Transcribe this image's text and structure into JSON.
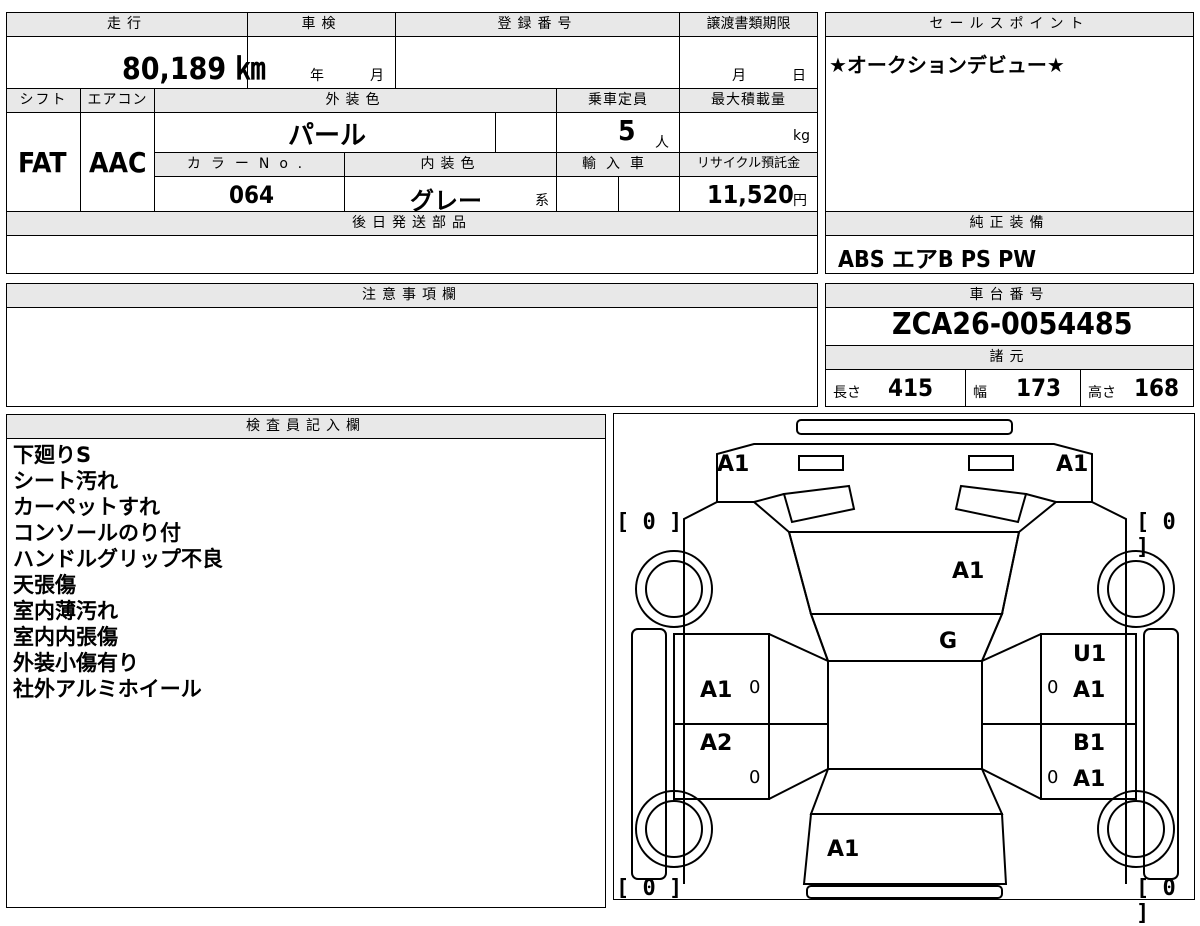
{
  "spec": {
    "mileage_label": "走行",
    "mileage": "80,189 ㎞",
    "shaken_label": "車検",
    "shaken_year_unit": "年",
    "shaken_month_unit": "月",
    "reg_no_label": "登録番号",
    "transfer_label": "譲渡書類期限",
    "transfer_month_unit": "月",
    "transfer_day_unit": "日",
    "shift_label": "シフト",
    "aircon_label": "エアコン",
    "ext_color_label": "外装色",
    "capacity_label": "乗車定員",
    "max_load_label": "最大積載量",
    "shift": "FAT",
    "aircon": "AAC",
    "ext_color": "パール",
    "capacity": "5",
    "capacity_unit": "人",
    "max_load_unit": "kg",
    "color_no_label": "カラーNo.",
    "int_color_label": "内装色",
    "import_label": "輸入車",
    "recycle_label": "リサイクル預託金",
    "color_no": "064",
    "int_color": "グレー",
    "int_color_suffix": "系",
    "recycle_fee": "11,520",
    "recycle_unit": "円",
    "later_parts_label": "後日発送部品"
  },
  "sales_point": {
    "label": "セールスポイント",
    "text": "★オークションデビュー★"
  },
  "genuine_equipment": {
    "label": "純正装備",
    "text": "ABS エアB PS PW"
  },
  "notes_label": "注意事項欄",
  "chassis": {
    "label": "車台番号",
    "number": "ZCA26-0054485"
  },
  "dimensions": {
    "label": "諸元",
    "length_label": "長さ",
    "length": "415",
    "width_label": "幅",
    "width": "173",
    "height_label": "高さ",
    "height": "168"
  },
  "inspector": {
    "label": "検査員記入欄",
    "notes": [
      "下廻りS",
      "シート汚れ",
      "カーペットすれ",
      "コンソールのり付",
      "ハンドルグリップ不良",
      "天張傷",
      "室内薄汚れ",
      "室内内張傷",
      "外装小傷有り",
      "社外アルミホイール"
    ]
  },
  "diagram": {
    "front_left": "A1",
    "front_right": "A1",
    "hood": "A1",
    "windshield": "G",
    "right_front_door_top": "U1",
    "right_front_door": "A1",
    "left_front_door": "A1",
    "left_rear_door": "A2",
    "right_rear_door_top": "B1",
    "right_rear_door": "A1",
    "rear": "A1",
    "tire_fl": "[ 0 ]",
    "tire_fr": "[ 0 ]",
    "tire_rl": "[ 0 ]",
    "tire_rr": "[ 0 ]",
    "zero_lf": "0",
    "zero_lr": "0",
    "zero_rf": "0",
    "zero_rr": "0"
  }
}
